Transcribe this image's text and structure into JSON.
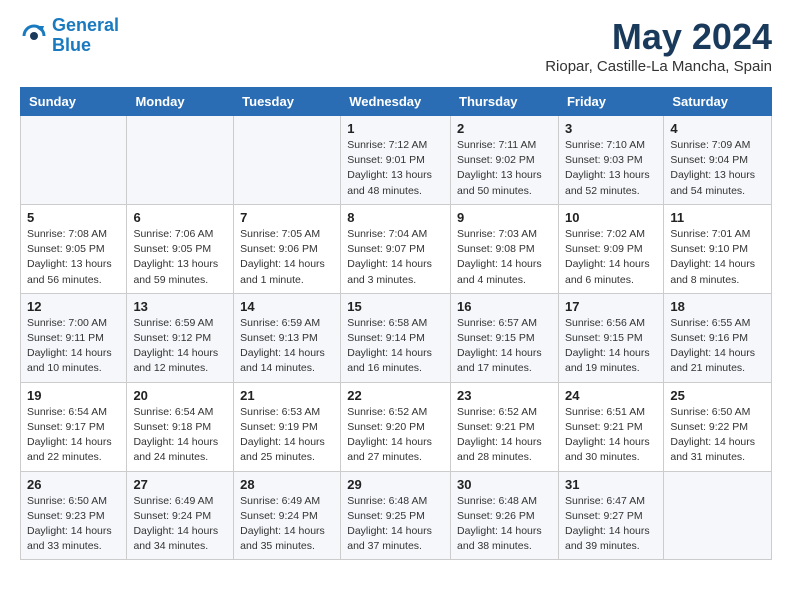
{
  "header": {
    "logo_line1": "General",
    "logo_line2": "Blue",
    "month": "May 2024",
    "location": "Riopar, Castille-La Mancha, Spain"
  },
  "weekdays": [
    "Sunday",
    "Monday",
    "Tuesday",
    "Wednesday",
    "Thursday",
    "Friday",
    "Saturday"
  ],
  "weeks": [
    [
      {
        "day": "",
        "info": ""
      },
      {
        "day": "",
        "info": ""
      },
      {
        "day": "",
        "info": ""
      },
      {
        "day": "1",
        "info": "Sunrise: 7:12 AM\nSunset: 9:01 PM\nDaylight: 13 hours\nand 48 minutes."
      },
      {
        "day": "2",
        "info": "Sunrise: 7:11 AM\nSunset: 9:02 PM\nDaylight: 13 hours\nand 50 minutes."
      },
      {
        "day": "3",
        "info": "Sunrise: 7:10 AM\nSunset: 9:03 PM\nDaylight: 13 hours\nand 52 minutes."
      },
      {
        "day": "4",
        "info": "Sunrise: 7:09 AM\nSunset: 9:04 PM\nDaylight: 13 hours\nand 54 minutes."
      }
    ],
    [
      {
        "day": "5",
        "info": "Sunrise: 7:08 AM\nSunset: 9:05 PM\nDaylight: 13 hours\nand 56 minutes."
      },
      {
        "day": "6",
        "info": "Sunrise: 7:06 AM\nSunset: 9:05 PM\nDaylight: 13 hours\nand 59 minutes."
      },
      {
        "day": "7",
        "info": "Sunrise: 7:05 AM\nSunset: 9:06 PM\nDaylight: 14 hours\nand 1 minute."
      },
      {
        "day": "8",
        "info": "Sunrise: 7:04 AM\nSunset: 9:07 PM\nDaylight: 14 hours\nand 3 minutes."
      },
      {
        "day": "9",
        "info": "Sunrise: 7:03 AM\nSunset: 9:08 PM\nDaylight: 14 hours\nand 4 minutes."
      },
      {
        "day": "10",
        "info": "Sunrise: 7:02 AM\nSunset: 9:09 PM\nDaylight: 14 hours\nand 6 minutes."
      },
      {
        "day": "11",
        "info": "Sunrise: 7:01 AM\nSunset: 9:10 PM\nDaylight: 14 hours\nand 8 minutes."
      }
    ],
    [
      {
        "day": "12",
        "info": "Sunrise: 7:00 AM\nSunset: 9:11 PM\nDaylight: 14 hours\nand 10 minutes."
      },
      {
        "day": "13",
        "info": "Sunrise: 6:59 AM\nSunset: 9:12 PM\nDaylight: 14 hours\nand 12 minutes."
      },
      {
        "day": "14",
        "info": "Sunrise: 6:59 AM\nSunset: 9:13 PM\nDaylight: 14 hours\nand 14 minutes."
      },
      {
        "day": "15",
        "info": "Sunrise: 6:58 AM\nSunset: 9:14 PM\nDaylight: 14 hours\nand 16 minutes."
      },
      {
        "day": "16",
        "info": "Sunrise: 6:57 AM\nSunset: 9:15 PM\nDaylight: 14 hours\nand 17 minutes."
      },
      {
        "day": "17",
        "info": "Sunrise: 6:56 AM\nSunset: 9:15 PM\nDaylight: 14 hours\nand 19 minutes."
      },
      {
        "day": "18",
        "info": "Sunrise: 6:55 AM\nSunset: 9:16 PM\nDaylight: 14 hours\nand 21 minutes."
      }
    ],
    [
      {
        "day": "19",
        "info": "Sunrise: 6:54 AM\nSunset: 9:17 PM\nDaylight: 14 hours\nand 22 minutes."
      },
      {
        "day": "20",
        "info": "Sunrise: 6:54 AM\nSunset: 9:18 PM\nDaylight: 14 hours\nand 24 minutes."
      },
      {
        "day": "21",
        "info": "Sunrise: 6:53 AM\nSunset: 9:19 PM\nDaylight: 14 hours\nand 25 minutes."
      },
      {
        "day": "22",
        "info": "Sunrise: 6:52 AM\nSunset: 9:20 PM\nDaylight: 14 hours\nand 27 minutes."
      },
      {
        "day": "23",
        "info": "Sunrise: 6:52 AM\nSunset: 9:21 PM\nDaylight: 14 hours\nand 28 minutes."
      },
      {
        "day": "24",
        "info": "Sunrise: 6:51 AM\nSunset: 9:21 PM\nDaylight: 14 hours\nand 30 minutes."
      },
      {
        "day": "25",
        "info": "Sunrise: 6:50 AM\nSunset: 9:22 PM\nDaylight: 14 hours\nand 31 minutes."
      }
    ],
    [
      {
        "day": "26",
        "info": "Sunrise: 6:50 AM\nSunset: 9:23 PM\nDaylight: 14 hours\nand 33 minutes."
      },
      {
        "day": "27",
        "info": "Sunrise: 6:49 AM\nSunset: 9:24 PM\nDaylight: 14 hours\nand 34 minutes."
      },
      {
        "day": "28",
        "info": "Sunrise: 6:49 AM\nSunset: 9:24 PM\nDaylight: 14 hours\nand 35 minutes."
      },
      {
        "day": "29",
        "info": "Sunrise: 6:48 AM\nSunset: 9:25 PM\nDaylight: 14 hours\nand 37 minutes."
      },
      {
        "day": "30",
        "info": "Sunrise: 6:48 AM\nSunset: 9:26 PM\nDaylight: 14 hours\nand 38 minutes."
      },
      {
        "day": "31",
        "info": "Sunrise: 6:47 AM\nSunset: 9:27 PM\nDaylight: 14 hours\nand 39 minutes."
      },
      {
        "day": "",
        "info": ""
      }
    ]
  ]
}
